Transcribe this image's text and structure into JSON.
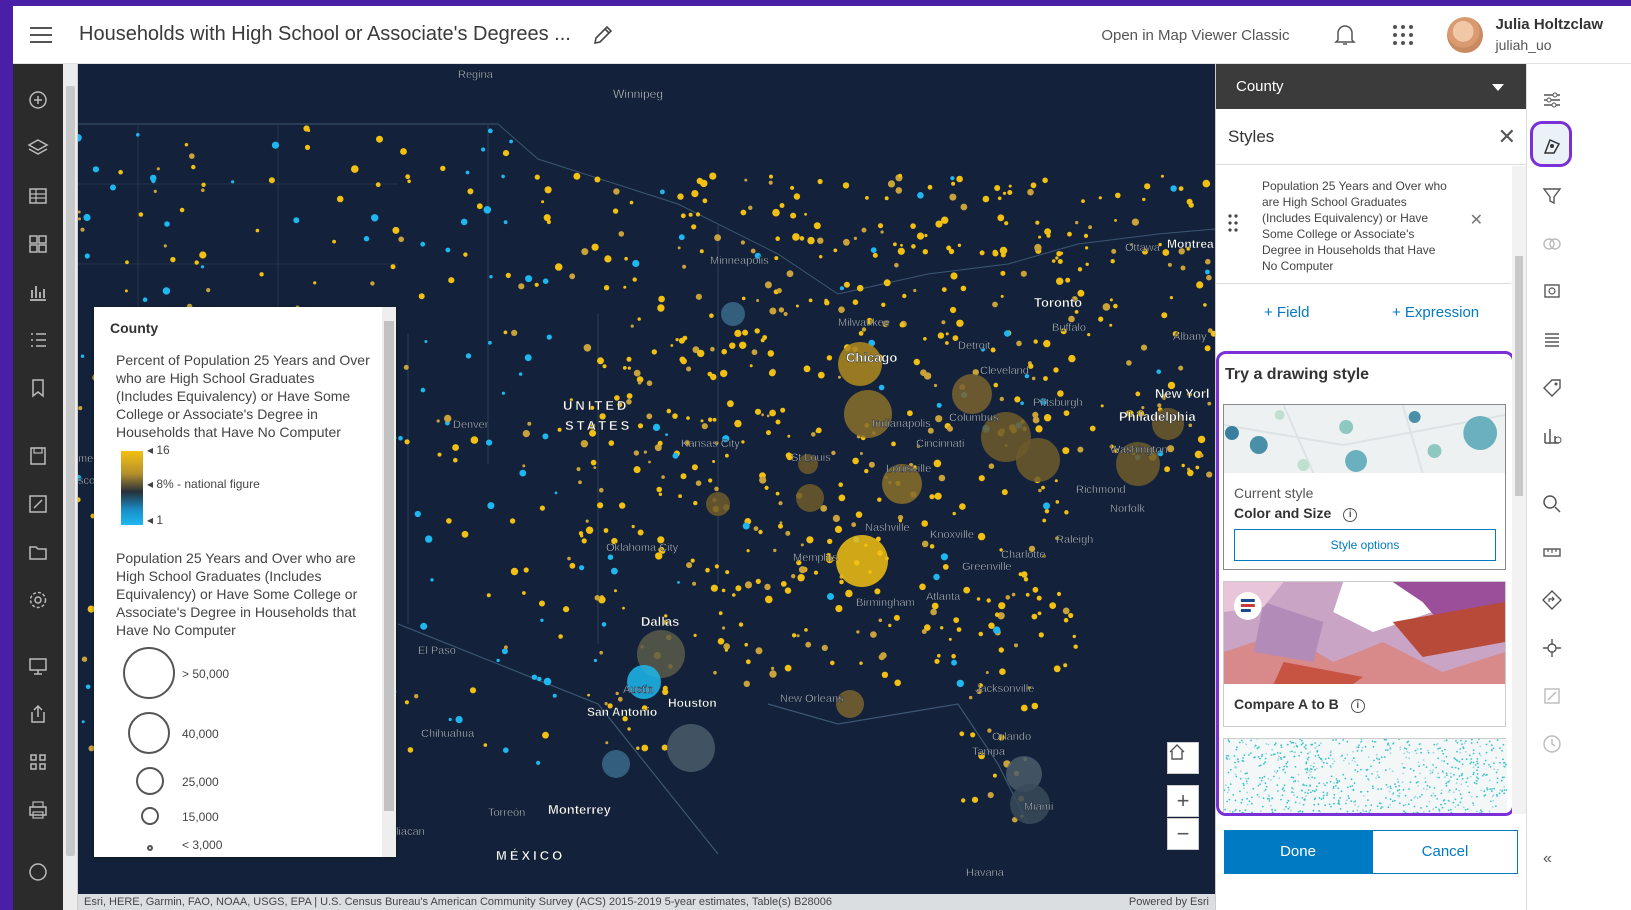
{
  "header": {
    "title": "Households with High School or Associate's Degrees ...",
    "open_classic": "Open in Map Viewer Classic",
    "user_name": "Julia Holtzclaw",
    "user_handle": "juliah_uo"
  },
  "map": {
    "labels": {
      "regina": "Regina",
      "winnipeg": "Winnipeg",
      "minneapolis": "Minneapolis",
      "milwaukee": "Milwaukee",
      "chicago": "Chicago",
      "detroit": "Detroit",
      "toronto": "Toronto",
      "buffalo": "Buffalo",
      "ottawa": "Ottawa",
      "montreal": "Montrea",
      "albany": "Albany",
      "cleveland": "Cleveland",
      "pittsburgh": "Pittsburgh",
      "new_york": "New Yorl",
      "philadelphia": "Philadelphia",
      "washington": "Washington",
      "columbus": "Columbus",
      "indianapolis": "Indianapolis",
      "cincinnati": "Cincinnati",
      "louisville": "Louisville",
      "st_louis": "St Louis",
      "kansas_city": "Kansas City",
      "denver": "Denver",
      "united_states": "UNITED",
      "states": "STATES",
      "richmond": "Richmond",
      "norfolk": "Norfolk",
      "raleigh": "Raleigh",
      "charlotte": "Charlotte",
      "greenville": "Greenville",
      "knoxville": "Knoxville",
      "nashville": "Nashville",
      "memphis": "Memphis",
      "oklahoma_city": "Oklahoma City",
      "atlanta": "Atlanta",
      "birmingham": "Birmingham",
      "dallas": "Dallas",
      "el_paso": "El Paso",
      "austin": "Austin",
      "houston": "Houston",
      "san_antonio": "San Antonio",
      "new_orleans": "New Orleans",
      "jacksonville": "Jacksonville",
      "orlando": "Orlando",
      "tampa": "Tampa",
      "miami": "Miami",
      "chihuahua": "Chihuahua",
      "torreon": "Torreón",
      "monterrey": "Monterrey",
      "mexico": "MÉXICO",
      "havana": "Havana",
      "culiacan": "liacan",
      "me_left": "me",
      "sco_left": "sco"
    },
    "attribution": "Esri, HERE, Garmin, FAO, NOAA, USGS, EPA | U.S. Census Bureau's American Community Survey (ACS) 2015-2019 5-year estimates, Table(s) B28006",
    "powered_by": "Powered by Esri",
    "zoom_in": "+",
    "zoom_out": "−"
  },
  "legend": {
    "title": "County",
    "color_title": "Percent of Population 25 Years and Over who are High School Graduates (Includes Equivalency) or Have Some College or Associate's Degree in Households that Have No Computer",
    "color_ticks": {
      "high": "16",
      "mid": "8% - national figure",
      "low": "1"
    },
    "size_title": "Population 25 Years and Over who are High School Graduates (Includes Equivalency) or Have Some College or Associate's Degree in Households that Have No Computer",
    "sizes": [
      "> 50,000",
      "40,000",
      "25,000",
      "15,000",
      "< 3,000"
    ]
  },
  "panel": {
    "layer": "County",
    "styles_title": "Styles",
    "field_text": "Population 25 Years and Over who are High School Graduates (Includes Equivalency) or Have Some College or Associate's Degree in Households that Have No Computer",
    "add_field": "+  Field",
    "add_expression": "+  Expression",
    "drawing_title": "Try a drawing style",
    "current_style_label": "Current style",
    "current_style_name": "Color and Size",
    "style_options": "Style options",
    "compare_name": "Compare A to B",
    "done": "Done",
    "cancel": "Cancel"
  },
  "colors": {
    "accent": "#007ac2",
    "highlight": "#7b2fd6",
    "map_bg": "#13223a",
    "dot_yellow": "#f2c012",
    "dot_blue": "#1fb7ef"
  }
}
